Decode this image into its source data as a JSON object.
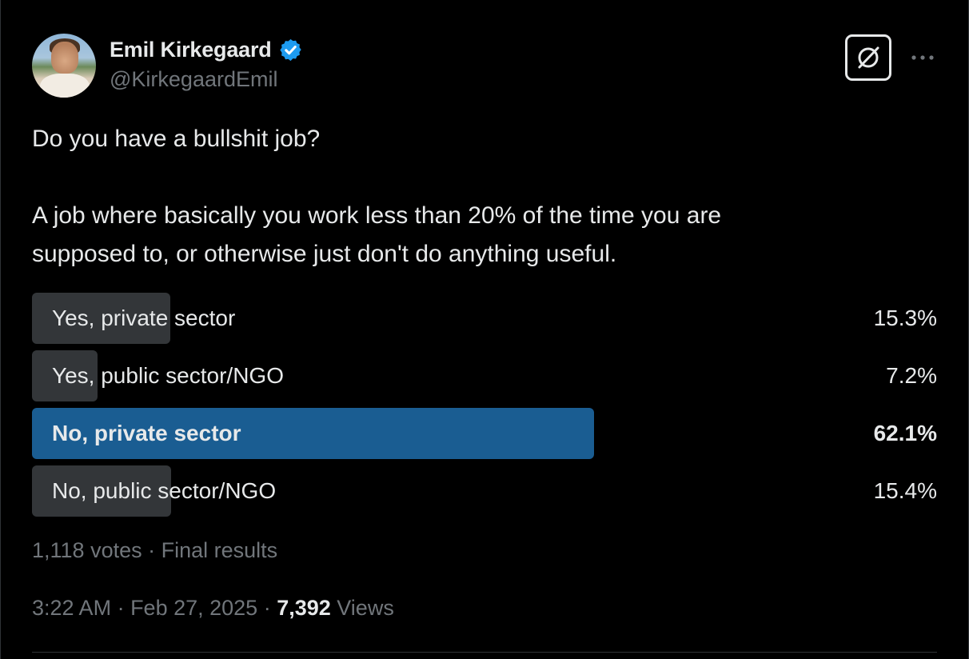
{
  "author": {
    "name": "Emil Kirkegaard",
    "handle": "@KirkegaardEmil",
    "verified": true,
    "badge_color": "#1d9bf0"
  },
  "header_actions": {
    "grok_icon": "grok-icon",
    "more_icon": "more-horizontal-icon"
  },
  "tweet": {
    "line1": "Do you have a bullshit job?",
    "line2": "A job where basically you work less than 20% of the time you are",
    "line3": "supposed to, or otherwise just don't do anything useful."
  },
  "poll": {
    "options": [
      {
        "label": "Yes, private sector",
        "percent_text": "15.3%",
        "percent": 15.3,
        "winner": false
      },
      {
        "label": "Yes, public sector/NGO",
        "percent_text": "7.2%",
        "percent": 7.2,
        "winner": false
      },
      {
        "label": "No, private sector",
        "percent_text": "62.1%",
        "percent": 62.1,
        "winner": true
      },
      {
        "label": "No, public sector/NGO",
        "percent_text": "15.4%",
        "percent": 15.4,
        "winner": false
      }
    ],
    "summary": "1,118 votes · Final results",
    "bar_color": "#333639",
    "winner_color": "#1a5d92"
  },
  "footer": {
    "time": "3:22 AM",
    "sep1": " · ",
    "date": "Feb 27, 2025",
    "sep2": " · ",
    "views_count": "7,392",
    "views_label": " Views"
  }
}
